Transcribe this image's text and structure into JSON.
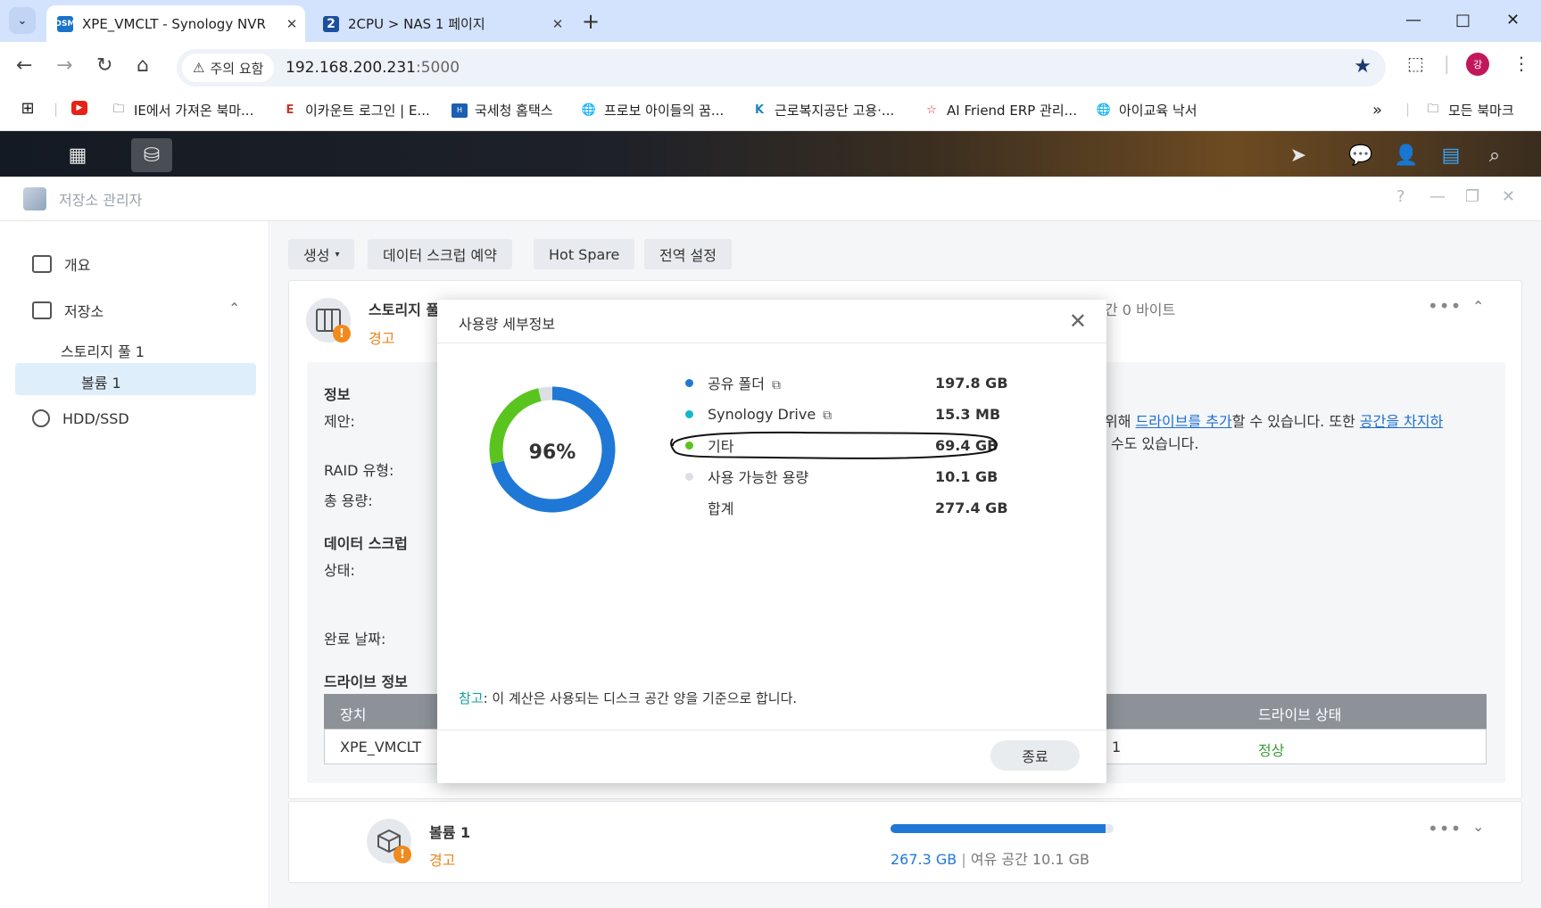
{
  "browser": {
    "tabs": [
      {
        "title": "XPE_VMCLT - Synology NVR",
        "favicon": "DSM",
        "active": true
      },
      {
        "title": "2CPU > NAS 1 페이지",
        "favicon": "2",
        "active": false
      }
    ],
    "security_chip": "주의 요함",
    "url_host": "192.168.200.231",
    "url_port": ":5000",
    "profile_initial": "강",
    "bookmarks": [
      {
        "label": "",
        "icon": "apps-icon"
      },
      {
        "label": "",
        "icon": "youtube-icon"
      },
      {
        "label": "IE에서 가져온 북마...",
        "icon": "folder-icon"
      },
      {
        "label": "이카운트 로그인 | E...",
        "icon": "ecount-icon"
      },
      {
        "label": "국세청 홈택스",
        "icon": "hometax-icon"
      },
      {
        "label": "프로보 아이들의 꿈...",
        "icon": "globe-icon"
      },
      {
        "label": "근로복지공단 고용·...",
        "icon": "kcomwel-icon"
      },
      {
        "label": "AI Friend ERP 관리...",
        "icon": "star-logo-icon"
      },
      {
        "label": "아이교육 낙서",
        "icon": "globe-icon"
      }
    ],
    "all_bookmarks_label": "모든 북마크"
  },
  "window": {
    "title": "저장소 관리자"
  },
  "sidebar": {
    "items": [
      {
        "label": "개요",
        "icon": "overview-icon"
      },
      {
        "label": "저장소",
        "icon": "storage-icon"
      },
      {
        "label": "스토리지 풀 1"
      },
      {
        "label": "볼륨 1"
      },
      {
        "label": "HDD/SSD",
        "icon": "hdd-icon"
      }
    ]
  },
  "toolbar": {
    "create_label": "생성",
    "scrub_label": "데이터 스크럽 예약",
    "hotspare_label": "Hot Spare",
    "global_label": "전역 설정"
  },
  "pool": {
    "title_partial": "스토리지 풀",
    "status": "경고",
    "right_partial": "간 0 바이트",
    "info_label": "정보",
    "suggest_label": "제안:",
    "suggest_text_1": "위해",
    "suggest_link_1": "드라이브를 추가",
    "suggest_text_2": "할 수 있습니다. 또한",
    "suggest_link_2": "공간을 차지하",
    "suggest_text_3": "수도 있습니다.",
    "raid_label": "RAID 유형:",
    "total_label": "총 용량:",
    "scrub_title": "데이터 스크럽",
    "state_label": "상태:",
    "done_label": "완료 날짜:",
    "drive_info": "드라이브 정보",
    "col_device": "장치",
    "col_status": "드라이브 상태",
    "row_device": "XPE_VMCLT",
    "row_num": "1",
    "row_status": "정상"
  },
  "volume": {
    "title": "볼륨 1",
    "status": "경고",
    "used": "267.3 GB",
    "free_label": "여유 공간 10.1 GB",
    "usage_fraction": 0.964
  },
  "modal": {
    "title": "사용량 세부정보",
    "percent": "96%",
    "rows": [
      {
        "name": "공유 폴더",
        "value": "197.8 GB",
        "color": "#1f78d6",
        "ext": true
      },
      {
        "name": "Synology Drive",
        "value": "15.3 MB",
        "color": "#14b8c8",
        "ext": true
      },
      {
        "name": "기타",
        "value": "69.4 GB",
        "color": "#5ac41e",
        "ext": false
      },
      {
        "name": "사용 가능한 용량",
        "value": "10.1 GB",
        "color": "#dcdfe3",
        "ext": false
      },
      {
        "name": "합계",
        "value": "277.4 GB",
        "color": "",
        "ext": false
      }
    ],
    "chart_segments": [
      {
        "name": "공유 폴더",
        "gb": 197.8,
        "color": "#1f78d6"
      },
      {
        "name": "Synology Drive",
        "gb": 0.0153,
        "color": "#14b8c8"
      },
      {
        "name": "기타",
        "gb": 69.4,
        "color": "#5ac41e"
      },
      {
        "name": "사용 가능한 용량",
        "gb": 10.1,
        "color": "#dcdfe3"
      }
    ],
    "note_key": "참고",
    "note_text": ": 이 계산은 사용되는 디스크 공간 양을 기준으로 합니다.",
    "close_label": "종료"
  }
}
